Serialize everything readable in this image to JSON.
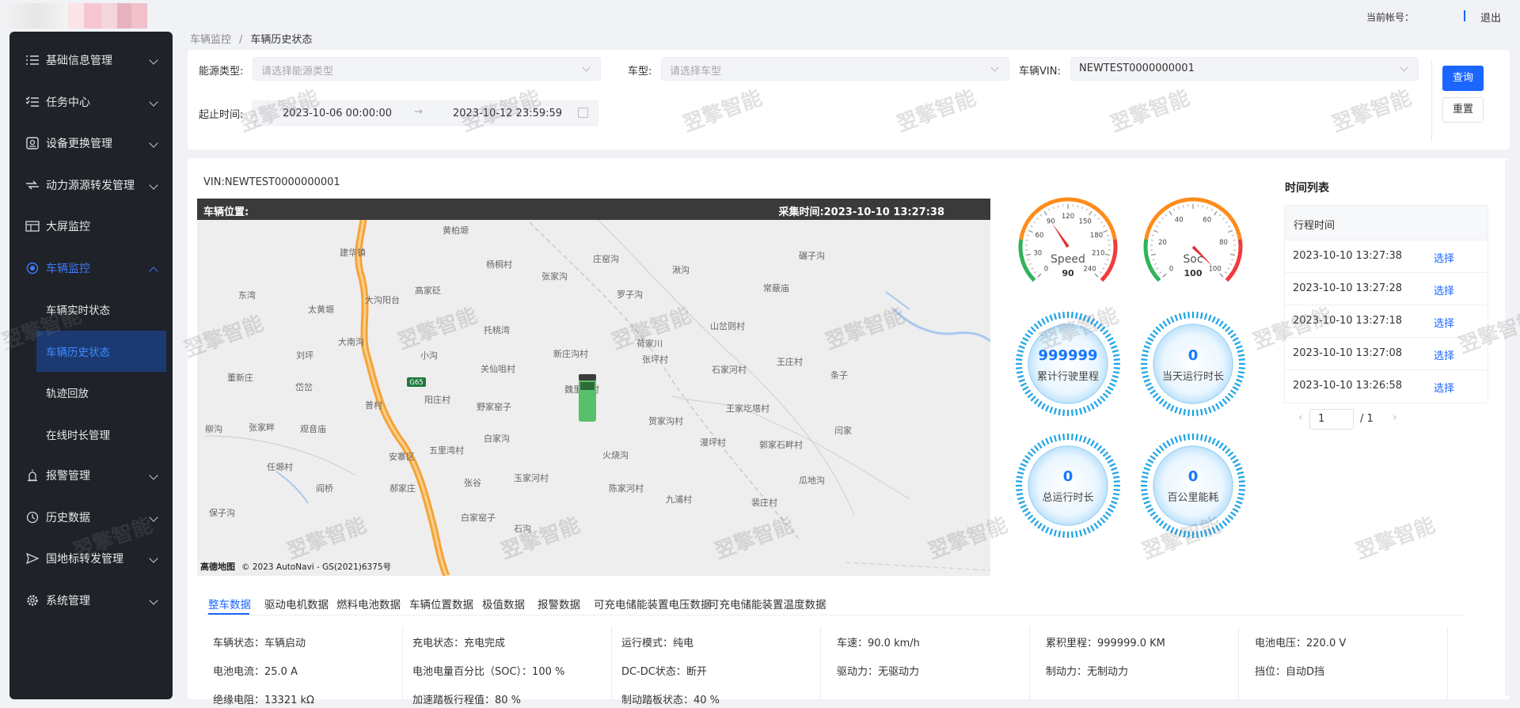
{
  "header": {
    "account_label": "当前帐号：",
    "logout_label": "退出"
  },
  "sidebar": {
    "items": [
      {
        "label": "基础信息管理",
        "icon": "list-icon"
      },
      {
        "label": "任务中心",
        "icon": "checklist-icon"
      },
      {
        "label": "设备更换管理",
        "icon": "device-icon"
      },
      {
        "label": "动力源源转发管理",
        "icon": "power-forward-icon"
      },
      {
        "label": "大屏监控",
        "icon": "screen-icon"
      },
      {
        "label": "车辆监控",
        "icon": "target-icon",
        "open": true,
        "children": [
          "车辆实时状态",
          "车辆历史状态",
          "轨迹回放",
          "在线时长管理"
        ]
      },
      {
        "label": "报警管理",
        "icon": "alarm-icon"
      },
      {
        "label": "历史数据",
        "icon": "history-icon"
      },
      {
        "label": "国地标转发管理",
        "icon": "send-icon"
      },
      {
        "label": "系统管理",
        "icon": "gear-icon"
      }
    ]
  },
  "breadcrumb": {
    "parent": "车辆监控",
    "separator": "/",
    "current": "车辆历史状态"
  },
  "filter": {
    "energy_label": "能源类型:",
    "energy_placeholder": "请选择能源类型",
    "model_label": "车型:",
    "model_placeholder": "请选择车型",
    "vin_label": "车辆VIN:",
    "vin_value": "NEWTEST0000000001",
    "time_label": "起止时间:",
    "time_start": "2023-10-06 00:00:00",
    "time_arrow": "→",
    "time_end": "2023-10-12 23:59:59",
    "query_button": "查询",
    "reset_button": "重置"
  },
  "vehicle": {
    "vin_text": "VIN:NEWTEST0000000001"
  },
  "map": {
    "title": "车辆位置:",
    "collect_time": "采集时间:2023-10-10 13:27:38",
    "copyright": "© 2023 AutoNavi - GS(2021)6375号",
    "brand": "高德地图",
    "road_badge": "G65",
    "places": [
      [
        "建华镇",
        180,
        40
      ],
      [
        "黄柏塬",
        310,
        12
      ],
      [
        "杨桐村",
        365,
        55
      ],
      [
        "庄窑沟",
        500,
        48
      ],
      [
        "张家沟",
        435,
        70
      ],
      [
        "湫沟",
        600,
        62
      ],
      [
        "碾子沟",
        760,
        44
      ],
      [
        "东湾",
        52,
        94
      ],
      [
        "大沟阳台",
        212,
        100
      ],
      [
        "高家砭",
        275,
        88
      ],
      [
        "罗子沟",
        530,
        93
      ],
      [
        "常蔽庙",
        715,
        85
      ],
      [
        "太黄塬",
        140,
        112
      ],
      [
        "托桃湾",
        362,
        138
      ],
      [
        "山岔则村",
        648,
        133
      ],
      [
        "大南沟",
        178,
        153
      ],
      [
        "新庄沟村",
        450,
        168
      ],
      [
        "荷家川",
        555,
        155
      ],
      [
        "刘坪",
        125,
        170
      ],
      [
        "小沟",
        282,
        170
      ],
      [
        "关仙咀村",
        358,
        187
      ],
      [
        "张坪村",
        562,
        175
      ],
      [
        "王庄村",
        732,
        178
      ],
      [
        "石家河村",
        650,
        188
      ],
      [
        "条子",
        800,
        195
      ],
      [
        "董新庄",
        38,
        198
      ],
      [
        "岱岔",
        124,
        210
      ],
      [
        "魏里湾村",
        464,
        213
      ],
      [
        "阳庄村",
        287,
        226
      ],
      [
        "普村",
        212,
        233
      ],
      [
        "野家窑子",
        353,
        235
      ],
      [
        "王家圪塔村",
        668,
        237
      ],
      [
        "贺家沟村",
        570,
        253
      ],
      [
        "柳沟",
        10,
        263
      ],
      [
        "张家畔",
        65,
        261
      ],
      [
        "观音庙",
        130,
        263
      ],
      [
        "白家沟",
        362,
        275
      ],
      [
        "漫坪村",
        635,
        280
      ],
      [
        "郭家石畔村",
        710,
        283
      ],
      [
        "闫家",
        805,
        265
      ],
      [
        "五里湾村",
        293,
        290
      ],
      [
        "火烧沟",
        512,
        296
      ],
      [
        "安寨区",
        242,
        298
      ],
      [
        "任塬村",
        88,
        311
      ],
      [
        "张谷",
        337,
        331
      ],
      [
        "玉家河村",
        400,
        325
      ],
      [
        "阎桥",
        150,
        338
      ],
      [
        "郝家庄",
        243,
        338
      ],
      [
        "陈家河村",
        520,
        338
      ],
      [
        "瓜地沟",
        760,
        328
      ],
      [
        "九浦村",
        592,
        352
      ],
      [
        "裴庄村",
        700,
        356
      ],
      [
        "白家窑子",
        333,
        375
      ],
      [
        "保子沟",
        15,
        369
      ],
      [
        "石沟",
        400,
        389
      ]
    ]
  },
  "gauges": [
    {
      "label": "Speed",
      "value": "90",
      "ticks": [
        "0",
        "30",
        "60",
        "90",
        "120",
        "150",
        "180",
        "210",
        "240"
      ],
      "fraction": 0.375
    },
    {
      "label": "Soc",
      "value": "100",
      "ticks": [
        "0",
        "20",
        "40",
        "60",
        "80",
        "100"
      ],
      "fraction": 1.0
    }
  ],
  "stats": [
    {
      "value": "999999",
      "label": "累计行驶里程"
    },
    {
      "value": "0",
      "label": "当天运行时长"
    },
    {
      "value": "0",
      "label": "总运行时长"
    },
    {
      "value": "0",
      "label": "百公里能耗"
    }
  ],
  "time_list": {
    "title": "时间列表",
    "header": "行程时间",
    "select_label": "选择",
    "rows": [
      "2023-10-10 13:27:38",
      "2023-10-10 13:27:28",
      "2023-10-10 13:27:18",
      "2023-10-10 13:27:08",
      "2023-10-10 13:26:58"
    ],
    "page_current": "1",
    "page_total": "/ 1",
    "prev": "‹",
    "next": "›"
  },
  "tabs": [
    "整车数据",
    "驱动电机数据",
    "燃料电池数据",
    "车辆位置数据",
    "极值数据",
    "报警数据",
    "可充电储能装置电压数据",
    "可充电储能装置温度数据"
  ],
  "vehicle_data": {
    "columns": [
      [
        "车辆状态：车辆启动",
        "电池电流：25.0 A",
        "绝缘电阻：13321 kΩ"
      ],
      [
        "充电状态：充电完成",
        "电池电量百分比（SOC）：100 %",
        "加速踏板行程值：80 %"
      ],
      [
        "运行模式：纯电",
        "DC-DC状态：断开",
        "制动踏板状态：40 %"
      ],
      [
        "车速：90.0 km/h",
        "驱动力：无驱动力"
      ],
      [
        "累积里程：999999.0 KM",
        "制动力：无制动力"
      ],
      [
        "电池电压：220.0 V",
        "挡位：自动D挡"
      ]
    ]
  },
  "watermark": "翌擎智能",
  "colors": {
    "accent": "#1a66ff",
    "sidebar_bg": "#1f2228",
    "active_sub_bg": "#1c3a72",
    "gauge_cyan": "#1aa3e8"
  }
}
